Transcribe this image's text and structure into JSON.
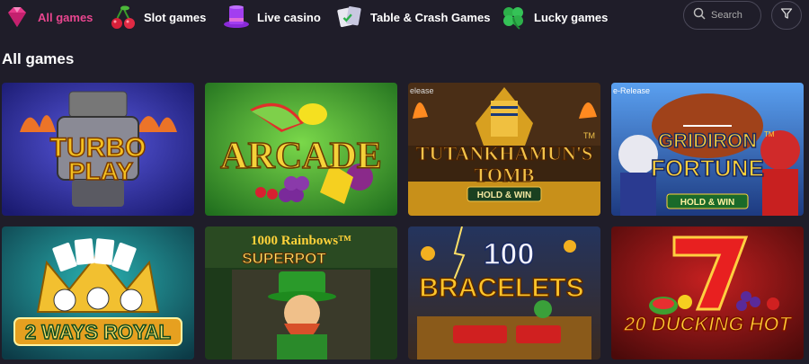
{
  "categories": [
    {
      "label": "All games",
      "icon": "gem-icon",
      "active": true
    },
    {
      "label": "Slot games",
      "icon": "cherries-icon",
      "active": false
    },
    {
      "label": "Live casino",
      "icon": "top-hat-icon",
      "active": false
    },
    {
      "label": "Table & Crash Games",
      "icon": "playing-cards-icon",
      "active": false
    },
    {
      "label": "Lucky games",
      "icon": "four-leaf-clover-icon",
      "active": false
    }
  ],
  "search": {
    "placeholder": "Search"
  },
  "section_title": "All games",
  "games": [
    {
      "title_lines": [
        "TURBO",
        "PLAY"
      ],
      "banner": "",
      "ribbon": "",
      "colors": {
        "bg": "#2a2faa",
        "text": "#f4c020"
      }
    },
    {
      "title_lines": [
        "ARCADE"
      ],
      "banner": "",
      "ribbon": "",
      "colors": {
        "bg": "#2e8a2a",
        "text": "#f5d23a"
      }
    },
    {
      "title_lines": [
        "TUTANKHAMUN'S",
        "TOMB"
      ],
      "banner": "HOLD & WIN",
      "ribbon": "elease",
      "colors": {
        "bg": "#3a2410",
        "text": "#f2c34a"
      }
    },
    {
      "title_lines": [
        "GRIDIRON",
        "FORTUNE"
      ],
      "banner": "HOLD & WIN",
      "ribbon": "e-Release",
      "colors": {
        "bg": "#3b7fd0",
        "text": "#ffd23a"
      }
    },
    {
      "title_lines": [
        "2 WAYS ROYAL"
      ],
      "banner": "",
      "ribbon": "",
      "colors": {
        "bg": "#16606a",
        "text": "#ffe066"
      }
    },
    {
      "title_lines": [
        "1000 Rainbows™",
        "SUPERPOT"
      ],
      "banner": "",
      "ribbon": "",
      "colors": {
        "bg": "#1d3a1a",
        "text": "#ffd23a"
      }
    },
    {
      "title_lines": [
        "100",
        "BRACELETS"
      ],
      "banner": "",
      "ribbon": "",
      "colors": {
        "bg": "#1d2c52",
        "text": "#ffc52a"
      }
    },
    {
      "title_lines": [
        "20 DUCKING HOT"
      ],
      "banner": "",
      "ribbon": "",
      "colors": {
        "bg": "#7a0f14",
        "text": "#ffcc33"
      }
    }
  ]
}
